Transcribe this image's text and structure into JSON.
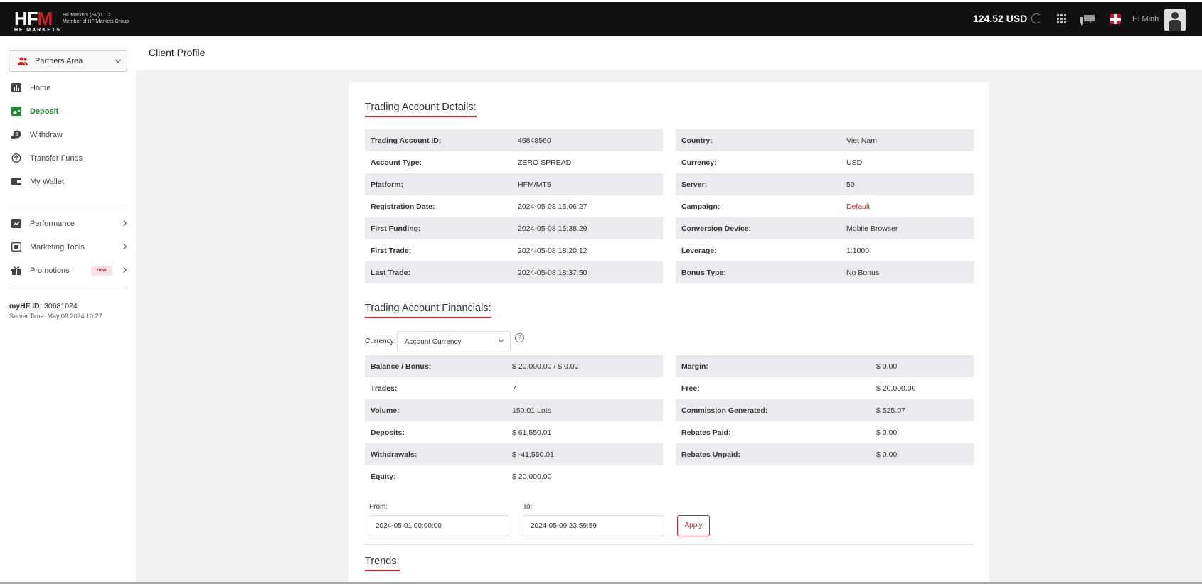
{
  "topbar": {
    "logo": {
      "mark_left": "HF",
      "mark_right": "M",
      "sub": "HF MARKETS",
      "tag_line1": "HF Markets (SV) LTD",
      "tag_line2": "Member of HF Markets Group"
    },
    "balance": "124.52 USD",
    "greeting": "Hi Minh"
  },
  "sidebar": {
    "area_selector": "Partners Area",
    "nav": [
      {
        "label": "Home",
        "icon": "chart-icon"
      },
      {
        "label": "Deposit",
        "icon": "deposit-icon",
        "active": true
      },
      {
        "label": "Withdraw",
        "icon": "withdraw-icon"
      },
      {
        "label": "Transfer Funds",
        "icon": "transfer-icon"
      },
      {
        "label": "My Wallet",
        "icon": "wallet-icon"
      }
    ],
    "nav2": [
      {
        "label": "Performance",
        "icon": "performance-icon"
      },
      {
        "label": "Marketing Tools",
        "icon": "marketing-icon"
      },
      {
        "label": "Promotions",
        "icon": "gift-icon",
        "badge": "new"
      }
    ],
    "myhf_label": "myHF ID:",
    "myhf_value": "30681024",
    "server_time": "Server Time: May 09 2024 10:27"
  },
  "page": {
    "title": "Client Profile"
  },
  "details": {
    "title": "Trading Account Details:",
    "left": [
      {
        "k": "Trading Account ID:",
        "v": "45848560"
      },
      {
        "k": "Account Type:",
        "v": "ZERO SPREAD"
      },
      {
        "k": "Platform:",
        "v": "HFM/MT5"
      },
      {
        "k": "Registration Date:",
        "v": "2024-05-08 15:06:27"
      },
      {
        "k": "First Funding:",
        "v": "2024-05-08 15:38:29"
      },
      {
        "k": "First Trade:",
        "v": "2024-05-08 18:20:12"
      },
      {
        "k": "Last Trade:",
        "v": "2024-05-08 18:37:50"
      }
    ],
    "right": [
      {
        "k": "Country:",
        "v": "Viet Nam"
      },
      {
        "k": "Currency:",
        "v": "USD"
      },
      {
        "k": "Server:",
        "v": "50"
      },
      {
        "k": "Campaign:",
        "v": "Default"
      },
      {
        "k": "Conversion Device:",
        "v": "Mobile Browser"
      },
      {
        "k": "Leverage:",
        "v": "1:1000"
      },
      {
        "k": "Bonus Type:",
        "v": "No Bonus"
      }
    ]
  },
  "financials": {
    "title": "Trading Account Financials:",
    "currency_label": "Currency:",
    "currency_value": "Account Currency",
    "left": [
      {
        "k": "Balance / Bonus:",
        "v": "$ 20,000.00 / $ 0.00"
      },
      {
        "k": "Trades:",
        "v": "7"
      },
      {
        "k": "Volume:",
        "v": "150.01 Lots"
      },
      {
        "k": "Deposits:",
        "v": "$ 61,550.01"
      },
      {
        "k": "Withdrawals:",
        "v": "$ -41,550.01"
      },
      {
        "k": "Equity:",
        "v": "$ 20,000.00"
      }
    ],
    "right": [
      {
        "k": "Margin:",
        "v": "$ 0.00"
      },
      {
        "k": "Free:",
        "v": "$ 20,000.00"
      },
      {
        "k": "Commission Generated:",
        "v": "$ 525.07"
      },
      {
        "k": "Rebates Paid:",
        "v": "$ 0.00"
      },
      {
        "k": "Rebates Unpaid:",
        "v": "$ 0.00"
      }
    ],
    "from_label": "From:",
    "from_value": "2024-05-01 00:00:00",
    "to_label": "To:",
    "to_value": "2024-05-09 23:59:59",
    "apply": "Apply"
  },
  "trends": {
    "title": "Trends:"
  },
  "colors": {
    "brand_red": "#d51f1f",
    "active_green": "#1a8a2e",
    "topbar": "#111111"
  }
}
